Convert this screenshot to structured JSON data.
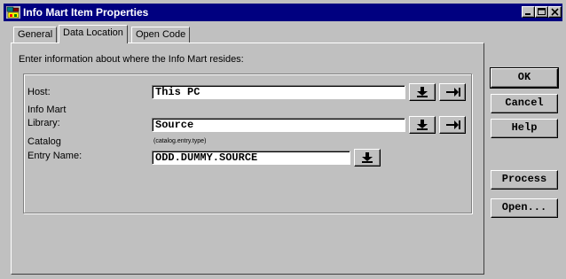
{
  "window": {
    "title": "Info Mart Item Properties",
    "controls": [
      "minimize-icon",
      "maximize-icon",
      "close-icon"
    ],
    "title_bar_color": "#000080"
  },
  "tabs": [
    {
      "label": "General",
      "active": false
    },
    {
      "label": "Data Location",
      "active": true
    },
    {
      "label": "Open Code",
      "active": false
    }
  ],
  "panel": {
    "instructions": "Enter information about where the Info Mart resides:",
    "host": {
      "label": "Host:",
      "value": "This PC"
    },
    "info_mart_label": "Info Mart",
    "library": {
      "label": "Library:",
      "value": "Source"
    },
    "catalog": {
      "label": "Catalog",
      "hint": "(catalog.entry.type)"
    },
    "entry_name": {
      "label": "Entry Name:",
      "value": "ODD.DUMMY.SOURCE"
    }
  },
  "buttons": {
    "ok": "OK",
    "cancel": "Cancel",
    "help": "Help",
    "process": "Process",
    "open": "Open..."
  },
  "icons": {
    "select": "down-arrow-icon",
    "browse": "right-arrow-icon"
  }
}
